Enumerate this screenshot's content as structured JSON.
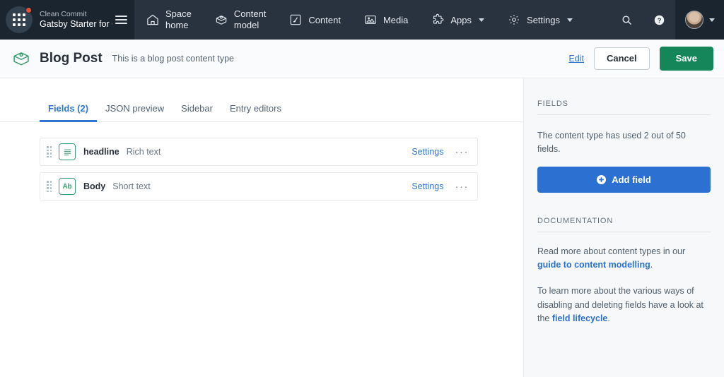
{
  "topnav": {
    "app_grid_icon": "app-grid-icon",
    "has_notification": true,
    "org_name": "Clean Commit",
    "space_name": "Gatsby Starter for Cont...",
    "menu_icon": "hamburger-icon",
    "items": [
      {
        "label_line1": "Space",
        "label_line2": "home",
        "icon": "home-icon",
        "has_caret": false
      },
      {
        "label_line1": "Content",
        "label_line2": "model",
        "icon": "content-model-icon",
        "has_caret": false
      },
      {
        "label_line1": "Content",
        "label_line2": "",
        "icon": "content-icon",
        "has_caret": false
      },
      {
        "label_line1": "Media",
        "label_line2": "",
        "icon": "media-icon",
        "has_caret": false
      },
      {
        "label_line1": "Apps",
        "label_line2": "",
        "icon": "apps-puzzle-icon",
        "has_caret": true
      },
      {
        "label_line1": "Settings",
        "label_line2": "",
        "icon": "gear-icon",
        "has_caret": true
      }
    ],
    "search_icon": "search-icon",
    "help_icon": "help-icon",
    "avatar_icon": "avatar"
  },
  "header": {
    "icon": "content-type-box-icon",
    "title": "Blog Post",
    "description": "This is a blog post content type",
    "edit_label": "Edit",
    "cancel_label": "Cancel",
    "save_label": "Save"
  },
  "tabs": [
    {
      "label": "Fields (2)",
      "active": true
    },
    {
      "label": "JSON preview",
      "active": false
    },
    {
      "label": "Sidebar",
      "active": false
    },
    {
      "label": "Entry editors",
      "active": false
    }
  ],
  "fields": [
    {
      "name": "headline",
      "type": "Rich text",
      "icon": "rich-text-icon",
      "settings_label": "Settings",
      "menu_label": "···"
    },
    {
      "name": "Body",
      "type": "Short text",
      "icon": "short-text-icon",
      "icon_text": "Ab",
      "settings_label": "Settings",
      "menu_label": "···"
    }
  ],
  "sidebar": {
    "fields_heading": "FIELDS",
    "fields_usage": "The content type has used 2 out of 50 fields.",
    "add_field_label": "Add field",
    "docs_heading": "DOCUMENTATION",
    "docs_p1_before": "Read more about content types in our ",
    "docs_p1_link": "guide to content modelling",
    "docs_p1_after": ".",
    "docs_p2_before": "To learn more about the various ways of disabling and deleting fields have a look at the ",
    "docs_p2_link": "field lifecycle",
    "docs_p2_after": "."
  },
  "colors": {
    "nav_bg": "#29333f",
    "nav_brand_bg": "#1b2530",
    "accent_blue": "#2c71d1",
    "accent_green": "#14865a",
    "field_icon_green": "#3c9c72",
    "sidebar_bg": "#f6f8f9",
    "notification_red": "#e8503a"
  }
}
